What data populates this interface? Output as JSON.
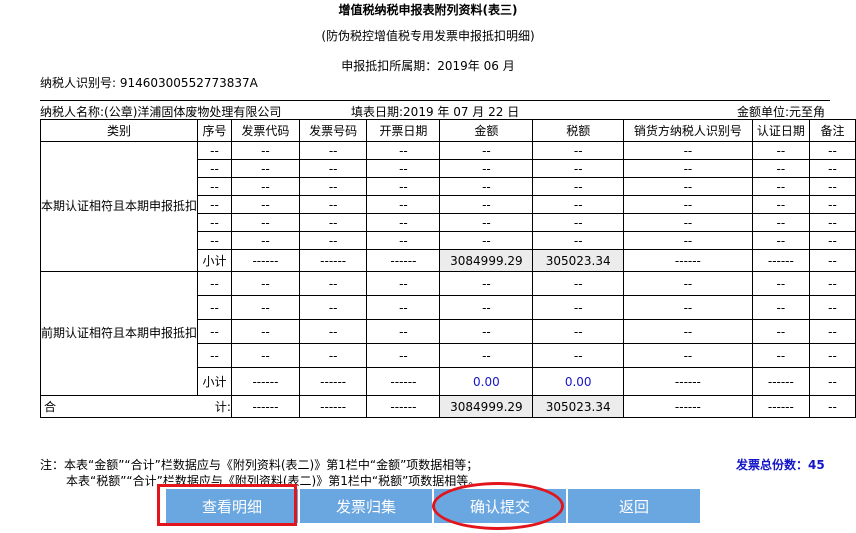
{
  "header": {
    "title": "增值税纳税申报表附列资料(表三)",
    "subtitle": "(防伪税控增值税专用发票申报抵扣明细)",
    "period": "申报抵扣所属期：2019年 06 月",
    "taxpayer_id": "纳税人识别号: 91460300552773837A",
    "taxpayer_name": "纳税人名称:(公章)洋浦固体废物处理有限公司",
    "fill_date": "填表日期:2019 年 07 月 22 日",
    "amount_unit": "金额单位:元至角"
  },
  "table": {
    "columns": [
      "类别",
      "序号",
      "发票代码",
      "发票号码",
      "开票日期",
      "金额",
      "税额",
      "销货方纳税人识别号",
      "认证日期",
      "备注"
    ],
    "empty": "--",
    "dashes": "------",
    "section1": {
      "category": "本期认证相符且本期申报抵扣",
      "subtotal_label": "小计",
      "amount": "3084999.29",
      "tax": "305023.34"
    },
    "section2": {
      "category": "前期认证相符且本期申报抵扣",
      "subtotal_label": "小计",
      "amount": "0.00",
      "tax": "0.00"
    },
    "total": {
      "label_left": "合",
      "label_right": "计:",
      "amount": "3084999.29",
      "tax": "305023.34"
    }
  },
  "notes": {
    "line1": "注：本表“金额”“合计”栏数据应与《附列资料(表二)》第1栏中“金额”项数据相等；",
    "line2": "本表“税额”“合计”栏数据应与《附列资料(表二)》第1栏中“税额”项数据相等。",
    "invoice_total": "发票总份数：45"
  },
  "buttons": {
    "view_detail": "查看明细",
    "collect": "发票归集",
    "confirm_submit": "确认提交",
    "back": "返回"
  },
  "colors": {
    "button": "#6aa6df",
    "highlight": "#e2151d",
    "blue_text": "#1515c8"
  }
}
